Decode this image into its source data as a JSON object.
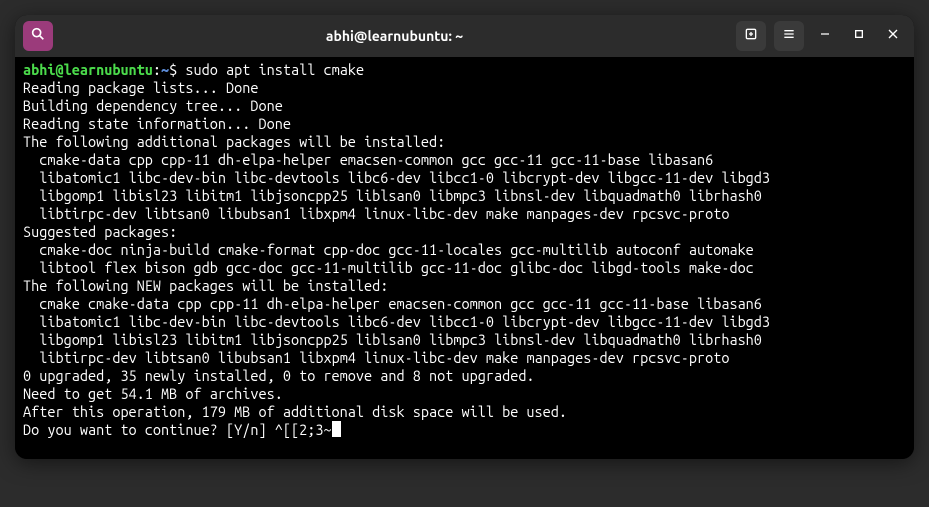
{
  "titlebar": {
    "title": "abhi@learnubuntu: ~"
  },
  "prompt": {
    "user_host": "abhi@learnubuntu",
    "sep1": ":",
    "path": "~",
    "sep2": "$",
    "command": "sudo apt install cmake"
  },
  "output": {
    "l1": "Reading package lists... Done",
    "l2": "Building dependency tree... Done",
    "l3": "Reading state information... Done",
    "l4": "The following additional packages will be installed:",
    "l5": "cmake-data cpp cpp-11 dh-elpa-helper emacsen-common gcc gcc-11 gcc-11-base libasan6",
    "l6": "libatomic1 libc-dev-bin libc-devtools libc6-dev libcc1-0 libcrypt-dev libgcc-11-dev libgd3",
    "l7": "libgomp1 libisl23 libitm1 libjsoncpp25 liblsan0 libmpc3 libnsl-dev libquadmath0 librhash0",
    "l8": "libtirpc-dev libtsan0 libubsan1 libxpm4 linux-libc-dev make manpages-dev rpcsvc-proto",
    "l9": "Suggested packages:",
    "l10": "cmake-doc ninja-build cmake-format cpp-doc gcc-11-locales gcc-multilib autoconf automake",
    "l11": "libtool flex bison gdb gcc-doc gcc-11-multilib gcc-11-doc glibc-doc libgd-tools make-doc",
    "l12": "The following NEW packages will be installed:",
    "l13": "cmake cmake-data cpp cpp-11 dh-elpa-helper emacsen-common gcc gcc-11 gcc-11-base libasan6",
    "l14": "libatomic1 libc-dev-bin libc-devtools libc6-dev libcc1-0 libcrypt-dev libgcc-11-dev libgd3",
    "l15": "libgomp1 libisl23 libitm1 libjsoncpp25 liblsan0 libmpc3 libnsl-dev libquadmath0 librhash0",
    "l16": "libtirpc-dev libtsan0 libubsan1 libxpm4 linux-libc-dev make manpages-dev rpcsvc-proto",
    "l17": "0 upgraded, 35 newly installed, 0 to remove and 8 not upgraded.",
    "l18": "Need to get 54.1 MB of archives.",
    "l19": "After this operation, 179 MB of additional disk space will be used.",
    "l20": "Do you want to continue? [Y/n] ^[[2;3~"
  }
}
